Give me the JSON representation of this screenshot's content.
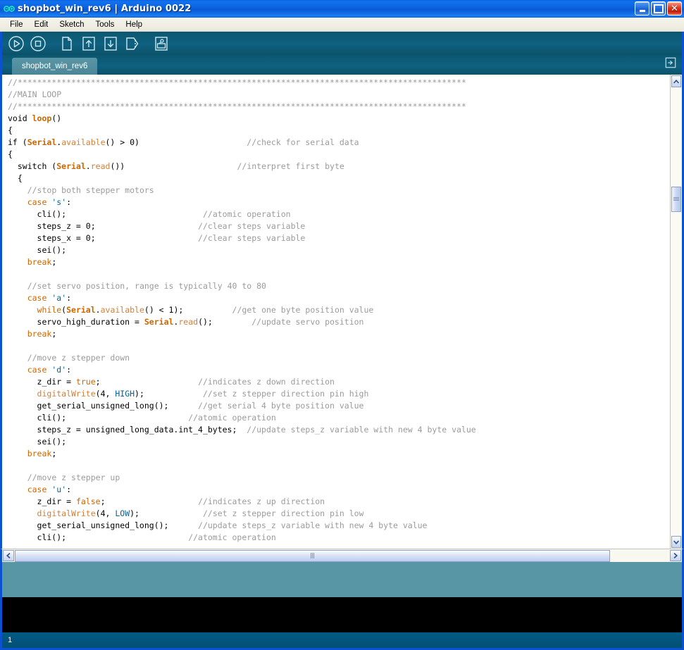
{
  "window": {
    "title": "shopbot_win_rev6 | Arduino 0022",
    "icon": "arduino-infinity-icon",
    "controls": {
      "minimize": "minimize-button",
      "maximize": "maximize-button",
      "close_label": "✕"
    }
  },
  "menubar": {
    "items": [
      {
        "label": "File"
      },
      {
        "label": "Edit"
      },
      {
        "label": "Sketch"
      },
      {
        "label": "Tools"
      },
      {
        "label": "Help"
      }
    ]
  },
  "toolbar": {
    "buttons": [
      {
        "name": "verify-button",
        "icon": "play-circle-icon",
        "tooltip": "Verify"
      },
      {
        "name": "stop-button",
        "icon": "stop-circle-icon",
        "tooltip": "Stop"
      },
      {
        "name": "new-button",
        "icon": "page-icon",
        "tooltip": "New"
      },
      {
        "name": "open-button",
        "icon": "arrow-up-box-icon",
        "tooltip": "Open"
      },
      {
        "name": "save-button",
        "icon": "arrow-down-box-icon",
        "tooltip": "Save"
      },
      {
        "name": "upload-button",
        "icon": "arrow-right-box-icon",
        "tooltip": "Upload"
      },
      {
        "name": "serial-monitor-button",
        "icon": "serial-monitor-icon",
        "tooltip": "Serial Monitor"
      }
    ]
  },
  "tabs": {
    "items": [
      {
        "label": "shopbot_win_rev6",
        "active": true
      }
    ],
    "menu_button": "tab-list-button"
  },
  "editor": {
    "lines": [
      [
        {
          "t": "//********************************************************************************************",
          "c": "c-comment"
        }
      ],
      [
        {
          "t": "//MAIN LOOP",
          "c": "c-comment"
        }
      ],
      [
        {
          "t": "//********************************************************************************************",
          "c": "c-comment"
        }
      ],
      [
        {
          "t": "void ",
          "c": ""
        },
        {
          "t": "loop",
          "c": "c-kw"
        },
        {
          "t": "()",
          "c": ""
        }
      ],
      [
        {
          "t": "{",
          "c": ""
        }
      ],
      [
        {
          "t": "if (",
          "c": ""
        },
        {
          "t": "Serial",
          "c": "c-kw"
        },
        {
          "t": ".",
          "c": ""
        },
        {
          "t": "available",
          "c": "c-fn"
        },
        {
          "t": "() > 0)",
          "c": ""
        },
        {
          "t": "                      ",
          "c": ""
        },
        {
          "t": "//check for serial data",
          "c": "c-comment"
        }
      ],
      [
        {
          "t": "{",
          "c": ""
        }
      ],
      [
        {
          "t": "  switch (",
          "c": ""
        },
        {
          "t": "Serial",
          "c": "c-kw"
        },
        {
          "t": ".",
          "c": ""
        },
        {
          "t": "read",
          "c": "c-fn"
        },
        {
          "t": "())",
          "c": ""
        },
        {
          "t": "                       ",
          "c": ""
        },
        {
          "t": "//interpret first byte",
          "c": "c-comment"
        }
      ],
      [
        {
          "t": "  {",
          "c": ""
        }
      ],
      [
        {
          "t": "    ",
          "c": ""
        },
        {
          "t": "//stop both stepper motors",
          "c": "c-comment"
        }
      ],
      [
        {
          "t": "    ",
          "c": ""
        },
        {
          "t": "case",
          "c": "c-kw2"
        },
        {
          "t": " ",
          "c": ""
        },
        {
          "t": "'s'",
          "c": "c-lit"
        },
        {
          "t": ":",
          "c": ""
        }
      ],
      [
        {
          "t": "      cli();",
          "c": ""
        },
        {
          "t": "                            ",
          "c": ""
        },
        {
          "t": "//atomic operation",
          "c": "c-comment"
        }
      ],
      [
        {
          "t": "      steps_z = 0;",
          "c": ""
        },
        {
          "t": "                     ",
          "c": ""
        },
        {
          "t": "//clear steps variable",
          "c": "c-comment"
        }
      ],
      [
        {
          "t": "      steps_x = 0;",
          "c": ""
        },
        {
          "t": "                     ",
          "c": ""
        },
        {
          "t": "//clear steps variable",
          "c": "c-comment"
        }
      ],
      [
        {
          "t": "      sei();",
          "c": ""
        }
      ],
      [
        {
          "t": "    ",
          "c": ""
        },
        {
          "t": "break",
          "c": "c-kw2"
        },
        {
          "t": ";",
          "c": ""
        }
      ],
      [
        {
          "t": "",
          "c": ""
        }
      ],
      [
        {
          "t": "    ",
          "c": ""
        },
        {
          "t": "//set servo position, range is typically 40 to 80",
          "c": "c-comment"
        }
      ],
      [
        {
          "t": "    ",
          "c": ""
        },
        {
          "t": "case",
          "c": "c-kw2"
        },
        {
          "t": " ",
          "c": ""
        },
        {
          "t": "'a'",
          "c": "c-lit"
        },
        {
          "t": ":",
          "c": ""
        }
      ],
      [
        {
          "t": "      ",
          "c": ""
        },
        {
          "t": "while",
          "c": "c-kw2"
        },
        {
          "t": "(",
          "c": ""
        },
        {
          "t": "Serial",
          "c": "c-kw"
        },
        {
          "t": ".",
          "c": ""
        },
        {
          "t": "available",
          "c": "c-fn"
        },
        {
          "t": "() < 1);",
          "c": ""
        },
        {
          "t": "          ",
          "c": ""
        },
        {
          "t": "//get one byte position value",
          "c": "c-comment"
        }
      ],
      [
        {
          "t": "      servo_high_duration = ",
          "c": ""
        },
        {
          "t": "Serial",
          "c": "c-kw"
        },
        {
          "t": ".",
          "c": ""
        },
        {
          "t": "read",
          "c": "c-fn"
        },
        {
          "t": "();",
          "c": ""
        },
        {
          "t": "        ",
          "c": ""
        },
        {
          "t": "//update servo position",
          "c": "c-comment"
        }
      ],
      [
        {
          "t": "    ",
          "c": ""
        },
        {
          "t": "break",
          "c": "c-kw2"
        },
        {
          "t": ";",
          "c": ""
        }
      ],
      [
        {
          "t": "",
          "c": ""
        }
      ],
      [
        {
          "t": "    ",
          "c": ""
        },
        {
          "t": "//move z stepper down",
          "c": "c-comment"
        }
      ],
      [
        {
          "t": "    ",
          "c": ""
        },
        {
          "t": "case",
          "c": "c-kw2"
        },
        {
          "t": " ",
          "c": ""
        },
        {
          "t": "'d'",
          "c": "c-lit"
        },
        {
          "t": ":",
          "c": ""
        }
      ],
      [
        {
          "t": "      z_dir = ",
          "c": ""
        },
        {
          "t": "true",
          "c": "c-kw2"
        },
        {
          "t": ";",
          "c": ""
        },
        {
          "t": "                    ",
          "c": ""
        },
        {
          "t": "//indicates z down direction",
          "c": "c-comment"
        }
      ],
      [
        {
          "t": "      ",
          "c": ""
        },
        {
          "t": "digitalWrite",
          "c": "c-fn"
        },
        {
          "t": "(4, ",
          "c": ""
        },
        {
          "t": "HIGH",
          "c": "c-lit"
        },
        {
          "t": ");",
          "c": ""
        },
        {
          "t": "            ",
          "c": ""
        },
        {
          "t": "//set z stepper direction pin high",
          "c": "c-comment"
        }
      ],
      [
        {
          "t": "      get_serial_unsigned_long();",
          "c": ""
        },
        {
          "t": "      ",
          "c": ""
        },
        {
          "t": "//get serial 4 byte position value",
          "c": "c-comment"
        }
      ],
      [
        {
          "t": "      cli();",
          "c": ""
        },
        {
          "t": "                         ",
          "c": ""
        },
        {
          "t": "//atomic operation",
          "c": "c-comment"
        }
      ],
      [
        {
          "t": "      steps_z = unsigned_long_data.int_4_bytes;",
          "c": ""
        },
        {
          "t": "  ",
          "c": ""
        },
        {
          "t": "//update steps_z variable with new 4 byte value",
          "c": "c-comment"
        }
      ],
      [
        {
          "t": "      sei();",
          "c": ""
        }
      ],
      [
        {
          "t": "    ",
          "c": ""
        },
        {
          "t": "break",
          "c": "c-kw2"
        },
        {
          "t": ";",
          "c": ""
        }
      ],
      [
        {
          "t": "",
          "c": ""
        }
      ],
      [
        {
          "t": "    ",
          "c": ""
        },
        {
          "t": "//move z stepper up",
          "c": "c-comment"
        }
      ],
      [
        {
          "t": "    ",
          "c": ""
        },
        {
          "t": "case",
          "c": "c-kw2"
        },
        {
          "t": " ",
          "c": ""
        },
        {
          "t": "'u'",
          "c": "c-lit"
        },
        {
          "t": ":",
          "c": ""
        }
      ],
      [
        {
          "t": "      z_dir = ",
          "c": ""
        },
        {
          "t": "false",
          "c": "c-kw2"
        },
        {
          "t": ";",
          "c": ""
        },
        {
          "t": "                   ",
          "c": ""
        },
        {
          "t": "//indicates z up direction",
          "c": "c-comment"
        }
      ],
      [
        {
          "t": "      ",
          "c": ""
        },
        {
          "t": "digitalWrite",
          "c": "c-fn"
        },
        {
          "t": "(4, ",
          "c": ""
        },
        {
          "t": "LOW",
          "c": "c-lit"
        },
        {
          "t": ");",
          "c": ""
        },
        {
          "t": "             ",
          "c": ""
        },
        {
          "t": "//set z stepper direction pin low",
          "c": "c-comment"
        }
      ],
      [
        {
          "t": "      get_serial_unsigned_long();",
          "c": ""
        },
        {
          "t": "      ",
          "c": ""
        },
        {
          "t": "//update steps_z variable with new 4 byte value",
          "c": "c-comment"
        }
      ],
      [
        {
          "t": "      cli();",
          "c": ""
        },
        {
          "t": "                         ",
          "c": ""
        },
        {
          "t": "//atomic operation",
          "c": "c-comment"
        }
      ]
    ]
  },
  "console": {
    "text": ""
  },
  "statusbar": {
    "line_number": "1"
  },
  "colors": {
    "titlebar_blue": "#0b5fe8",
    "toolbar_teal": "#0e6180",
    "tab_teal": "#4f8d9d",
    "message_strip": "#5896a5",
    "console_bg": "#000000",
    "statusbar_bg": "#025a83",
    "comment": "#9b9b9b",
    "keyword": "#cc6600",
    "function": "#d0803a",
    "literal": "#006699",
    "close_button_red": "#c41c06"
  }
}
